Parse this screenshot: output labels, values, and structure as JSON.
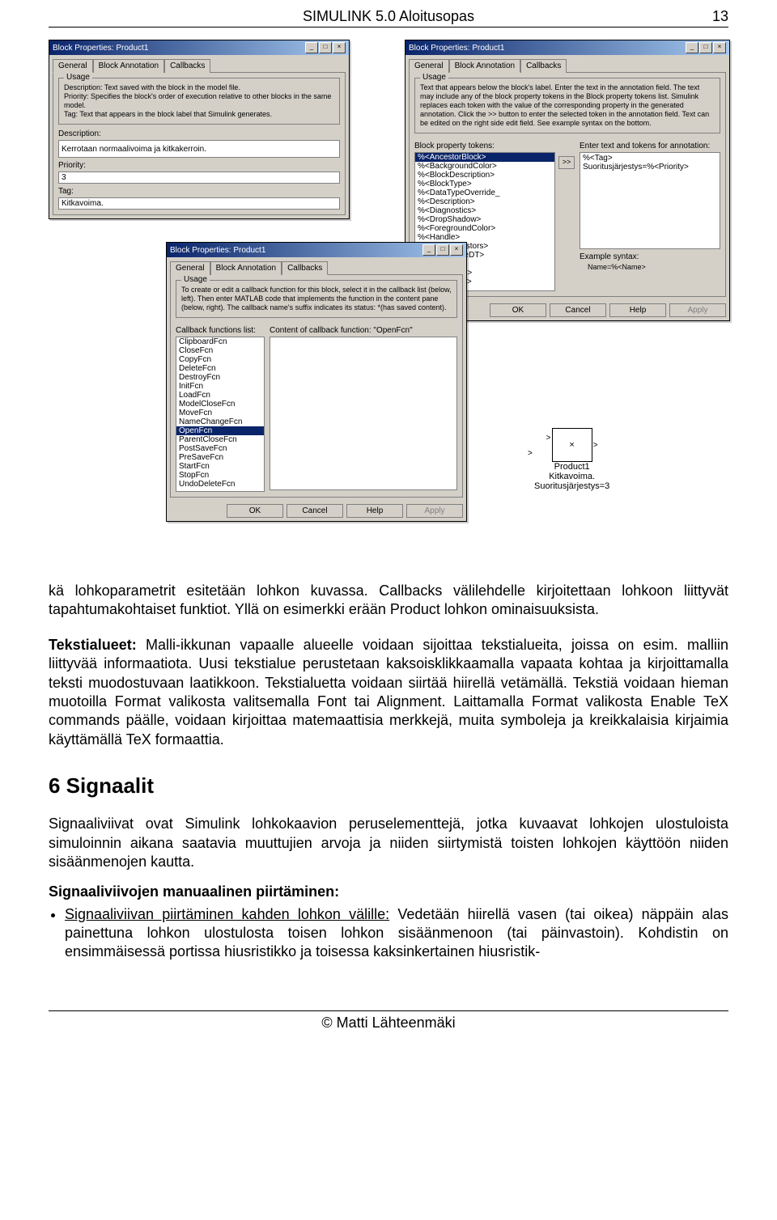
{
  "header": {
    "title": "SIMULINK 5.0 Aloitusopas",
    "page_num": "13"
  },
  "win_general": {
    "title": "Block Properties: Product1",
    "tabs": [
      "General",
      "Block Annotation",
      "Callbacks"
    ],
    "usage_title": "Usage",
    "usage_text": "Description: Text saved with the block in the model file.\nPriority: Specifies the block's order of execution relative to other blocks in the same model.\nTag: Text that appears in the block label that Simulink generates.",
    "desc_label": "Description:",
    "desc_value": "Kerrotaan normaalivoima ja kitkakerroin.",
    "priority_label": "Priority:",
    "priority_value": "3",
    "tag_label": "Tag:",
    "tag_value": "Kitkavoima."
  },
  "win_annot": {
    "title": "Block Properties: Product1",
    "tabs": [
      "General",
      "Block Annotation",
      "Callbacks"
    ],
    "usage_title": "Usage",
    "usage_text": "Text that appears below the block's label. Enter the text in the annotation field. The text may include any of the block property tokens in the Block property tokens list. Simulink replaces each token with the value of the corresponding property in the generated annotation. Click the >> button to enter the selected token in the annotation field. Text can be edited on the right side edit field. See example syntax on the bottom.",
    "tokens_label": "Block property tokens:",
    "annotation_label": "Enter text and tokens for annotation:",
    "tokens": [
      "%<AncestorBlock>",
      "%<BackgroundColor>",
      "%<BlockDescription>",
      "%<BlockType>",
      "%<DataTypeOverride_",
      "%<Description>",
      "%<Diagnostics>",
      "%<DropShadow>",
      "%<ForegroundColor>",
      "%<Handle>",
      "%<HiliteAncestors>",
      "%<InputSameDT>",
      "%<Inputs>",
      "%<LinkStatus>",
      "%<LockScale>",
      "%<Mask>"
    ],
    "annot_value": "%<Tag>\nSuoritusjärjestys=%<Priority>",
    "example_label": "Example syntax:",
    "example_value": "Name=%<Name>",
    "transfer_btn": ">>"
  },
  "win_cb": {
    "title": "Block Properties: Product1",
    "tabs": [
      "General",
      "Block Annotation",
      "Callbacks"
    ],
    "usage_title": "Usage",
    "usage_text": "To create or edit a callback function for this block, select it in the callback list (below, left). Then enter MATLAB code that implements the function in the content pane (below, right). The callback name's suffix indicates its status: *(has saved content).",
    "list_label": "Callback functions list:",
    "content_label": "Content of callback function: \"OpenFcn\"",
    "fcns": [
      "ClipboardFcn",
      "CloseFcn",
      "CopyFcn",
      "DeleteFcn",
      "DestroyFcn",
      "InitFcn",
      "LoadFcn",
      "ModelCloseFcn",
      "MoveFcn",
      "NameChangeFcn",
      "OpenFcn",
      "ParentCloseFcn",
      "PostSaveFcn",
      "PreSaveFcn",
      "StartFcn",
      "StopFcn",
      "UndoDeleteFcn"
    ]
  },
  "buttons": {
    "ok": "OK",
    "cancel": "Cancel",
    "help": "Help",
    "apply": "Apply"
  },
  "block": {
    "name": "Product1",
    "line2": "Kitkavoima.",
    "line3": "Suoritusjärjestys=3",
    "symbol": "×"
  },
  "para1": "kä lohkoparametrit esitetään lohkon kuvassa. Callbacks välilehdelle kirjoitettaan lohkoon liittyvät tapahtumakohtaiset funktiot. Yllä on esimerkki erään Product lohkon ominaisuuksista.",
  "para2a": "Tekstialueet:",
  "para2b": " Malli-ikkunan vapaalle alueelle voidaan sijoittaa tekstialueita, joissa on esim. malliin liittyvää informaatiota. Uusi tekstialue perustetaan kaksoisklikkaamalla vapaata kohtaa ja kirjoittamalla teksti muodostuvaan laatikkoon. Tekstialuetta voidaan siirtää hiirellä vetämällä. Tekstiä voidaan hieman muotoilla Format valikosta valitsemalla Font tai Alignment. Laittamalla Format valikosta Enable TeX commands päälle, voidaan kirjoittaa matemaattisia merkkejä, muita symboleja ja kreikkalaisia kirjaimia käyttämällä TeX formaattia.",
  "sec6": "6  Signaalit",
  "para3": "Signaaliviivat ovat Simulink lohkokaavion peruselementtejä, jotka kuvaavat lohkojen ulostuloista simuloinnin aikana saatavia muuttujien arvoja ja niiden siirtymistä toisten lohkojen käyttöön niiden sisäänmenojen kautta.",
  "para4a": "Signaaliviivojen manuaalinen piirtäminen:",
  "para4b_u": "Signaaliviivan piirtäminen kahden lohkon välille:",
  "para4b": " Vedetään hiirellä vasen (tai oikea) näppäin alas painettuna lohkon ulostulosta toisen lohkon sisäänmenoon (tai päinvastoin). Kohdistin on ensimmäisessä portissa hiusristikko ja toisessa kaksinkertainen hiusristik-",
  "footer": "© Matti Lähteenmäki"
}
